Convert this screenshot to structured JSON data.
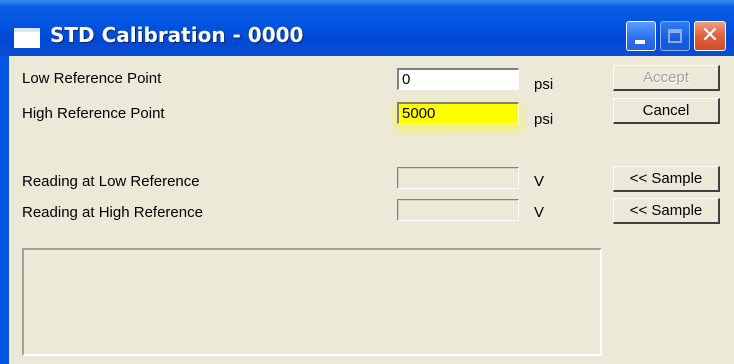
{
  "window": {
    "title": "STD Calibration - 0000",
    "controls": {
      "minimize": "minimize",
      "maximize": "maximize",
      "close": "close",
      "close_glyph": "✕"
    }
  },
  "form": {
    "low_reference": {
      "label": "Low Reference Point",
      "value": "0",
      "unit": "psi"
    },
    "high_reference": {
      "label": "High Reference Point",
      "value": "5000",
      "unit": "psi"
    },
    "reading_low": {
      "label": "Reading at Low Reference",
      "value": "",
      "unit": "V"
    },
    "reading_high": {
      "label": "Reading at High Reference",
      "value": "",
      "unit": "V"
    }
  },
  "buttons": {
    "accept": "Accept",
    "cancel": "Cancel",
    "sample_low": "<< Sample",
    "sample_high": "<< Sample"
  },
  "colors": {
    "titlebar": "#0052e0",
    "highlight": "#ffff00",
    "face": "#ece9d8"
  }
}
